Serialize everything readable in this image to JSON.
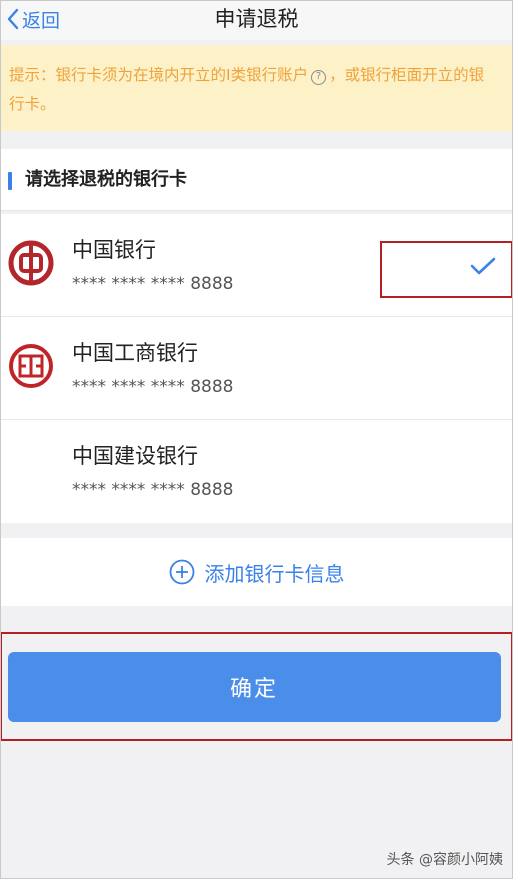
{
  "nav": {
    "back_label": "返回",
    "title": "申请退税"
  },
  "notice": {
    "text_before": "提示：银行卡须为在境内开立的I类银行账户",
    "text_after": "，或银行柜面开立的银行卡。",
    "help_glyph": "?"
  },
  "section": {
    "title": "请选择退税的银行卡"
  },
  "banks": [
    {
      "name": "中国银行",
      "card": "**** **** **** 8888",
      "logo": "bank-of-china-icon",
      "selected": true
    },
    {
      "name": "中国工商银行",
      "card": "**** **** **** 8888",
      "logo": "icbc-icon",
      "selected": false
    },
    {
      "name": "中国建设银行",
      "card": "**** **** **** 8888",
      "logo": "",
      "selected": false
    }
  ],
  "add_card": {
    "label": "添加银行卡信息"
  },
  "confirm": {
    "label": "确定"
  },
  "watermark": "头条 @容颜小阿姨",
  "colors": {
    "accent": "#3a82e8",
    "button": "#4a8eea",
    "notice_bg": "#fdf1c8",
    "notice_text": "#f0a23b",
    "highlight_border": "#b42025",
    "bank_red": "#b3262b"
  }
}
